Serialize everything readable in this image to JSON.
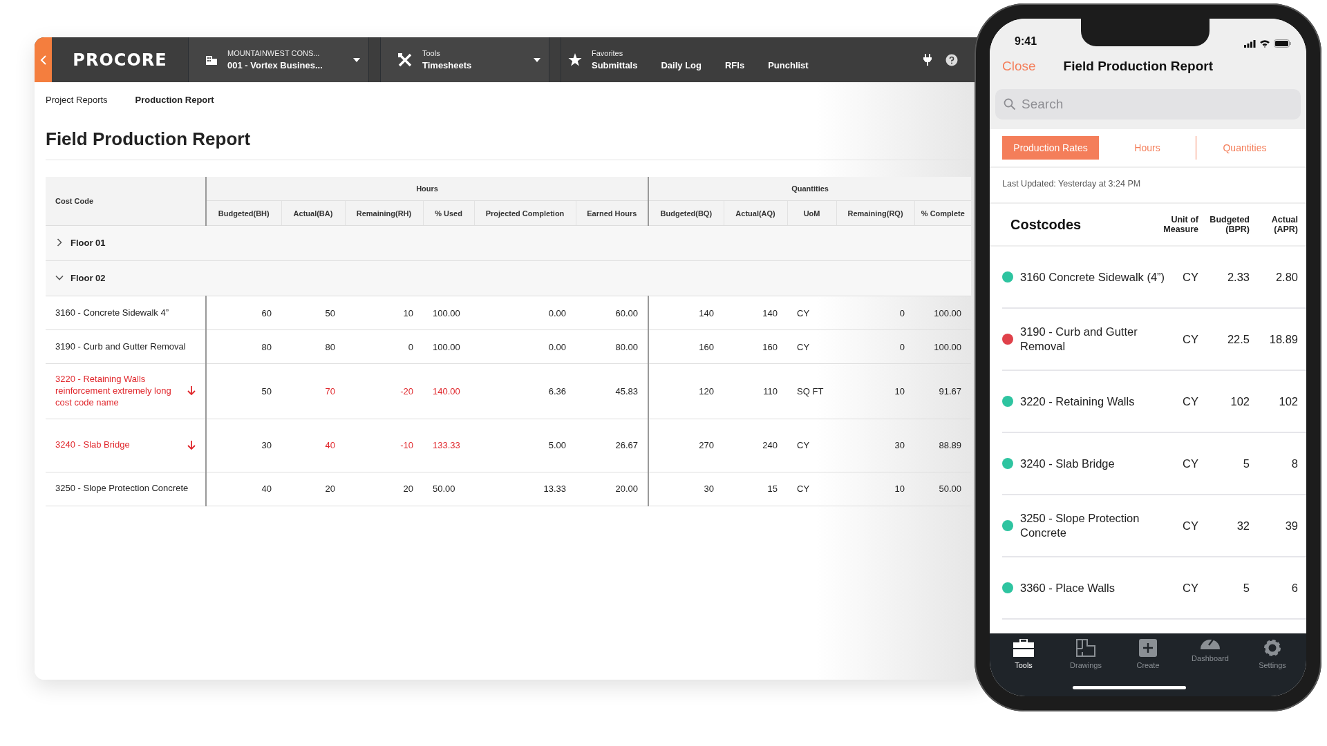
{
  "desktop": {
    "nav": {
      "logo": "PROCORE",
      "project": {
        "company": "MOUNTAINWEST CONS...",
        "name": "001 - Vortex Busines..."
      },
      "tool": {
        "label": "Tools",
        "value": "Timesheets"
      },
      "favorites": {
        "label": "Favorites",
        "items": [
          "Submittals",
          "Daily Log",
          "RFIs",
          "Punchlist"
        ]
      }
    },
    "breadcrumbs": [
      {
        "label": "Project Reports",
        "selected": false
      },
      {
        "label": "Production Report",
        "selected": true
      }
    ],
    "title": "Field Production Report",
    "table": {
      "first_column": "Cost Code",
      "groups": [
        {
          "label": "Hours",
          "columns": [
            "Budgeted(BH)",
            "Actual(BA)",
            "Remaining(RH)",
            "% Used",
            "Projected Completion",
            "Earned Hours"
          ]
        },
        {
          "label": "Quantities",
          "columns": [
            "Budgeted(BQ)",
            "Actual(AQ)",
            "UoM",
            "Remaining(RQ)",
            "% Complete"
          ]
        }
      ],
      "sections": [
        {
          "label": "Floor 01",
          "expanded": false
        },
        {
          "label": "Floor 02",
          "expanded": true,
          "rows": [
            {
              "cost_code": "3160 - Concrete Sidewalk 4”",
              "flagged": false,
              "cells": [
                "60",
                "50",
                "10",
                "100.00",
                "0.00",
                "60.00",
                "140",
                "140",
                "CY",
                "0",
                "100.00"
              ]
            },
            {
              "cost_code": "3190 - Curb and Gutter Removal",
              "flagged": false,
              "cells": [
                "80",
                "80",
                "0",
                "100.00",
                "0.00",
                "80.00",
                "160",
                "160",
                "CY",
                "0",
                "100.00"
              ]
            },
            {
              "cost_code": "3220 - Retaining Walls reinforcement extremely long cost code name",
              "flagged": true,
              "cells": [
                "50",
                "70",
                "-20",
                "140.00",
                "6.36",
                "45.83",
                "120",
                "110",
                "SQ FT",
                "10",
                "91.67"
              ]
            },
            {
              "cost_code": "3240 - Slab Bridge",
              "flagged": true,
              "cells": [
                "30",
                "40",
                "-10",
                "133.33",
                "5.00",
                "26.67",
                "270",
                "240",
                "CY",
                "30",
                "88.89"
              ]
            },
            {
              "cost_code": "3250 - Slope Protection Concrete",
              "flagged": false,
              "cells": [
                "40",
                "20",
                "20",
                "50.00",
                "13.33",
                "20.00",
                "30",
                "15",
                "CY",
                "10",
                "50.00"
              ]
            }
          ]
        }
      ]
    }
  },
  "phone": {
    "time": "9:41",
    "close": "Close",
    "title": "Field Production Report",
    "search": {
      "placeholder": "Search"
    },
    "tabs": [
      {
        "label": "Production Rates",
        "selected": true
      },
      {
        "label": "Hours",
        "selected": false
      },
      {
        "label": "Quantities",
        "selected": false
      }
    ],
    "last_updated": "Last Updated: Yesterday at 3:24 PM",
    "columns": [
      "Costcodes",
      "Unit of Measure",
      "Budgeted (BPR)",
      "Actual (APR)"
    ],
    "rows": [
      {
        "name": "3160 Concrete Sidewalk (4”)",
        "color": "#2ec4a0",
        "unit": "CY",
        "budgeted": "2.33",
        "actual": "2.80"
      },
      {
        "name": "3190 - Curb and Gutter Removal",
        "color": "#e0414a",
        "unit": "CY",
        "budgeted": "22.5",
        "actual": "18.89"
      },
      {
        "name": "3220 - Retaining Walls",
        "color": "#2ec4a0",
        "unit": "CY",
        "budgeted": "102",
        "actual": "102"
      },
      {
        "name": "3240 - Slab Bridge",
        "color": "#2ec4a0",
        "unit": "CY",
        "budgeted": "5",
        "actual": "8"
      },
      {
        "name": "3250 - Slope Protection Concrete",
        "color": "#2ec4a0",
        "unit": "CY",
        "budgeted": "32",
        "actual": "39"
      },
      {
        "name": "3360 - Place Walls",
        "color": "#2ec4a0",
        "unit": "CY",
        "budgeted": "5",
        "actual": "6"
      }
    ],
    "tab_bar": [
      {
        "kind": "tools",
        "label": "Tools",
        "selected": true
      },
      {
        "kind": "drawings",
        "label": "Drawings",
        "selected": false
      },
      {
        "kind": "create",
        "label": "Create",
        "selected": false
      },
      {
        "kind": "dashboard",
        "label": "Dashboard",
        "selected": false
      },
      {
        "kind": "settings",
        "label": "Settings",
        "selected": false
      }
    ]
  }
}
